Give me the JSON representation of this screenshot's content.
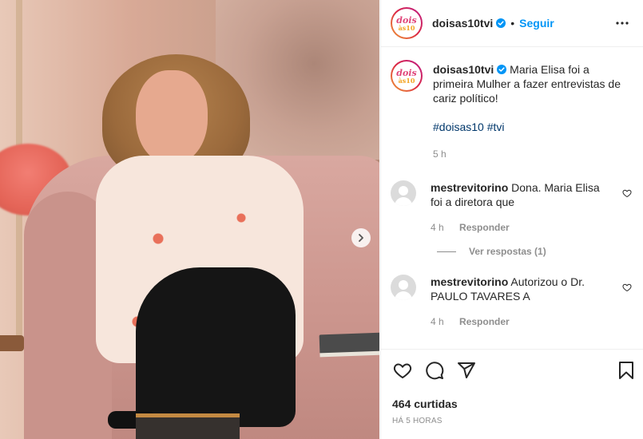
{
  "post": {
    "username": "doisas10tvi",
    "follow_label": "Seguir",
    "avatar_text_top": "dois",
    "avatar_text_bottom": "às10",
    "caption_text": "Maria Elisa foi a primeira Mulher a fazer entrevistas de cariz político!",
    "hashtags": [
      "#doisas10",
      "#tvi"
    ],
    "caption_time": "5 h"
  },
  "comments": [
    {
      "username": "mestrevitorino",
      "text": "Dona. Maria Elisa foi a diretora que",
      "time": "4 h",
      "reply_label": "Responder",
      "view_replies": "Ver respostas (1)"
    },
    {
      "username": "mestrevitorino",
      "text": "Autorizou o Dr. PAULO TAVARES A",
      "time": "4 h",
      "reply_label": "Responder"
    }
  ],
  "footer": {
    "likes": "464 curtidas",
    "time_ago": "HÁ 5 HORAS"
  },
  "icons": {
    "header_more": "more-horizontal-icon",
    "verified": "verified-badge-icon",
    "next": "chevron-right-icon",
    "like": "heart-icon",
    "comment": "comment-icon",
    "share": "share-icon",
    "save": "bookmark-icon"
  },
  "colors": {
    "link_blue": "#0095f6",
    "hashtag": "#00376b",
    "muted": "#8e8e8e",
    "text": "#262626"
  }
}
